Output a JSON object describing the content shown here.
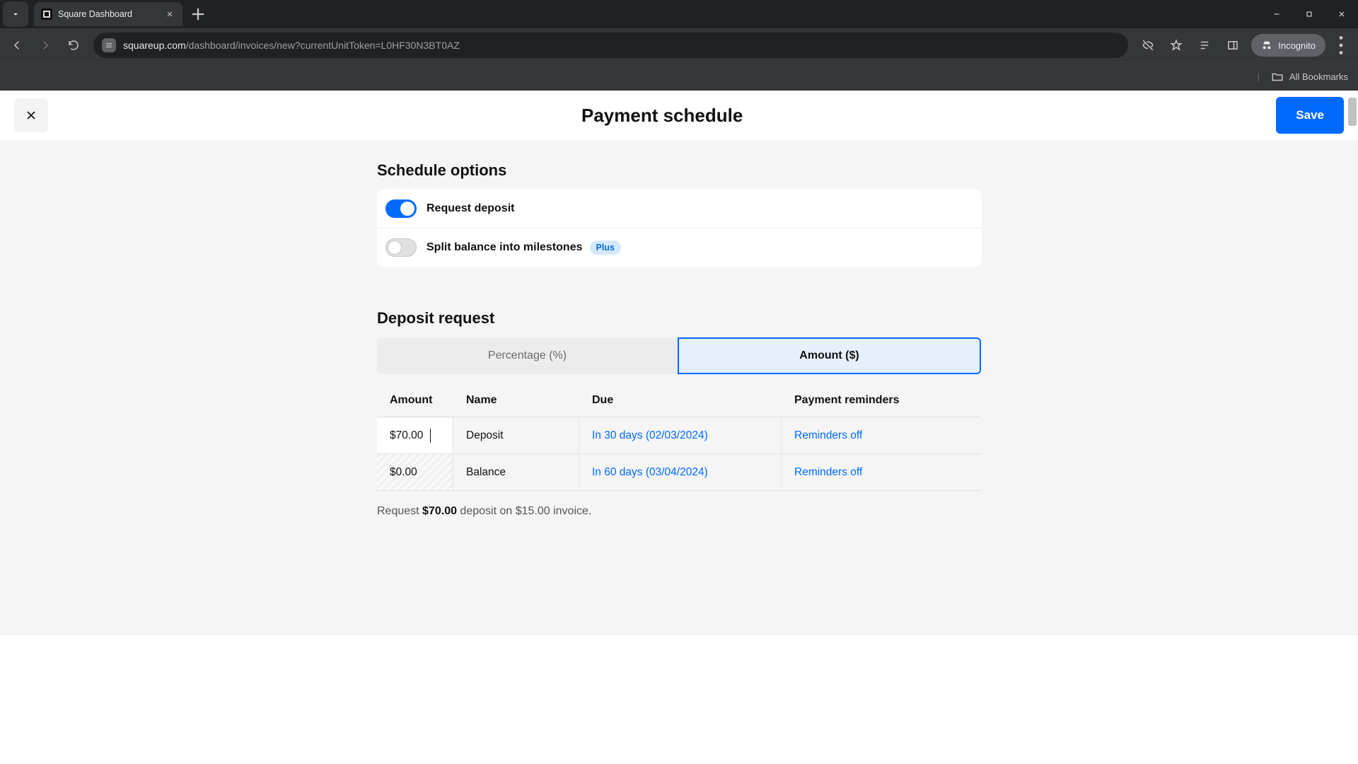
{
  "browser": {
    "tab_title": "Square Dashboard",
    "url_host": "squareup.com",
    "url_path": "/dashboard/invoices/new?currentUnitToken=L0HF30N3BT0AZ",
    "incognito_label": "Incognito",
    "bookmarks_label": "All Bookmarks"
  },
  "header": {
    "title": "Payment schedule",
    "save_label": "Save"
  },
  "schedule": {
    "section_title": "Schedule options",
    "deposit_label": "Request deposit",
    "milestones_label": "Split balance into milestones",
    "plus_badge": "Plus"
  },
  "deposit": {
    "section_title": "Deposit request",
    "tab_percentage": "Percentage (%)",
    "tab_amount": "Amount ($)",
    "columns": {
      "amount": "Amount",
      "name": "Name",
      "due": "Due",
      "reminders": "Payment reminders"
    },
    "rows": [
      {
        "amount": "$70.00",
        "name": "Deposit",
        "due": "In 30 days (02/03/2024)",
        "reminders": "Reminders off"
      },
      {
        "amount": "$0.00",
        "name": "Balance",
        "due": "In 60 days (03/04/2024)",
        "reminders": "Reminders off"
      }
    ],
    "summary_prefix": "Request ",
    "summary_amount": "$70.00",
    "summary_suffix": " deposit on $15.00 invoice."
  }
}
